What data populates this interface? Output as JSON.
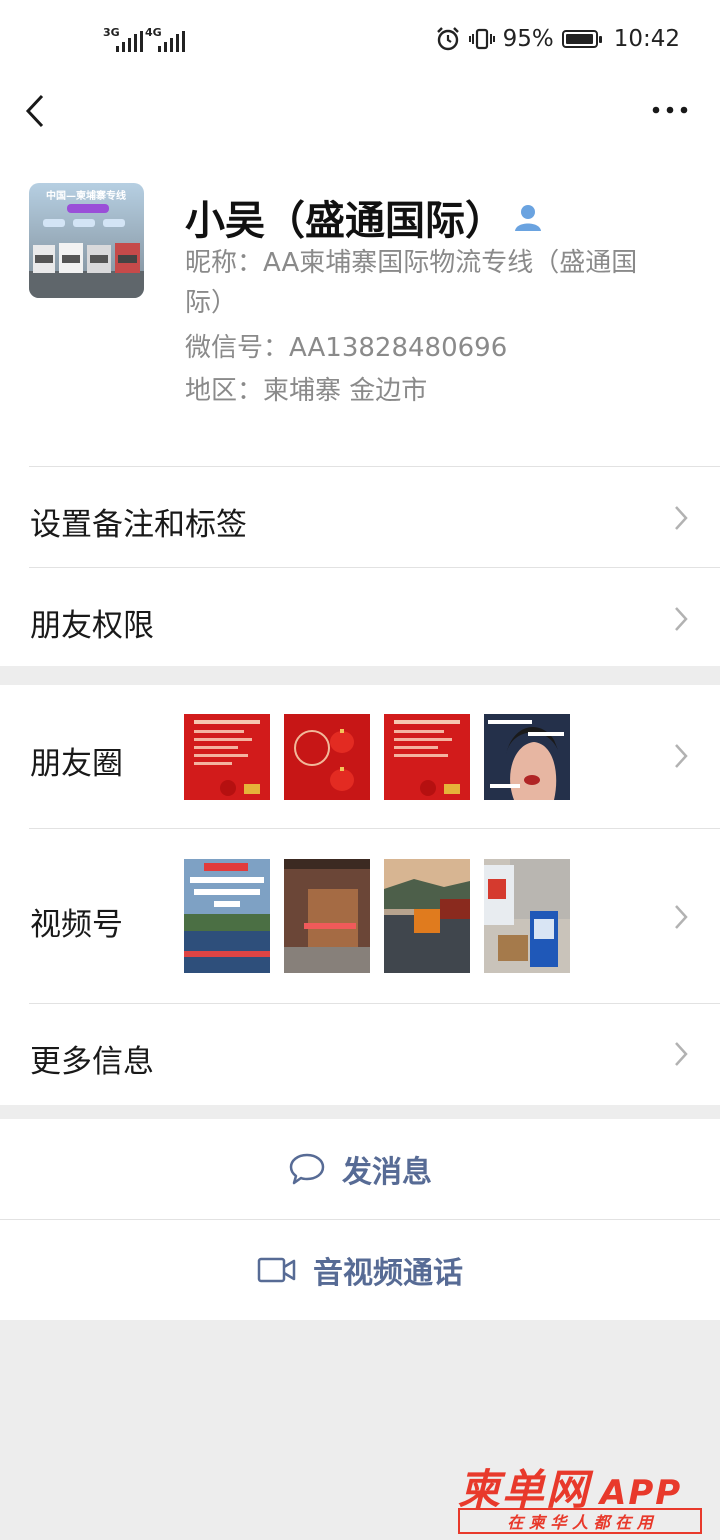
{
  "status_bar": {
    "signal1": "3G",
    "signal2": "4G",
    "battery_pct": "95%",
    "battery_level": 0.95,
    "time": "10:42"
  },
  "profile": {
    "name": "小吴（盛通国际）",
    "nickname_line1": "昵称：AA柬埔寨国际物流专线（盛通国",
    "nickname_line2": "际）",
    "wechat_id": "微信号：AA13828480696",
    "region": "地区：柬埔寨  金边市",
    "avatar_text": "中国—柬埔寨专线"
  },
  "menu": {
    "remarks": "设置备注和标签",
    "permissions": "朋友权限",
    "moments": "朋友圈",
    "channels": "视频号",
    "more_info": "更多信息"
  },
  "actions": {
    "message": "发消息",
    "call": "音视频通话"
  },
  "watermark": {
    "title": "柬单网",
    "app": "APP",
    "slogan": "在 柬 华 人 都 在 用"
  },
  "colors": {
    "link": "#576b95",
    "watermark": "#e8392b"
  }
}
